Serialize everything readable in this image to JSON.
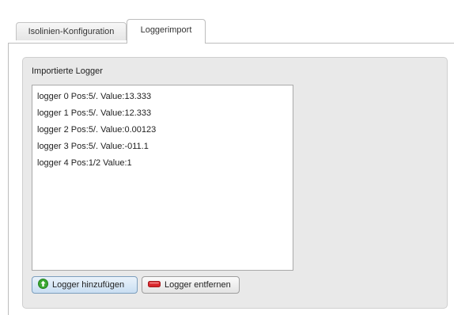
{
  "tabs": [
    {
      "label": "Isolinien-Konfiguration",
      "active": false
    },
    {
      "label": "Loggerimport",
      "active": true
    }
  ],
  "group": {
    "title": "Importierte Logger",
    "items": [
      "logger 0 Pos:5/. Value:13.333",
      "logger 1 Pos:5/. Value:12.333",
      "logger 2 Pos:5/. Value:0.00123",
      "logger 3 Pos:5/. Value:-011.1",
      "logger 4 Pos:1/2 Value:1"
    ]
  },
  "buttons": {
    "add_label": "Logger hinzufügen",
    "add_icon": "green-add-icon",
    "remove_label": "Logger entfernen",
    "remove_icon": "red-minus-icon"
  },
  "colors": {
    "add_icon": "#3aa832",
    "remove_icon": "#d8262b"
  }
}
